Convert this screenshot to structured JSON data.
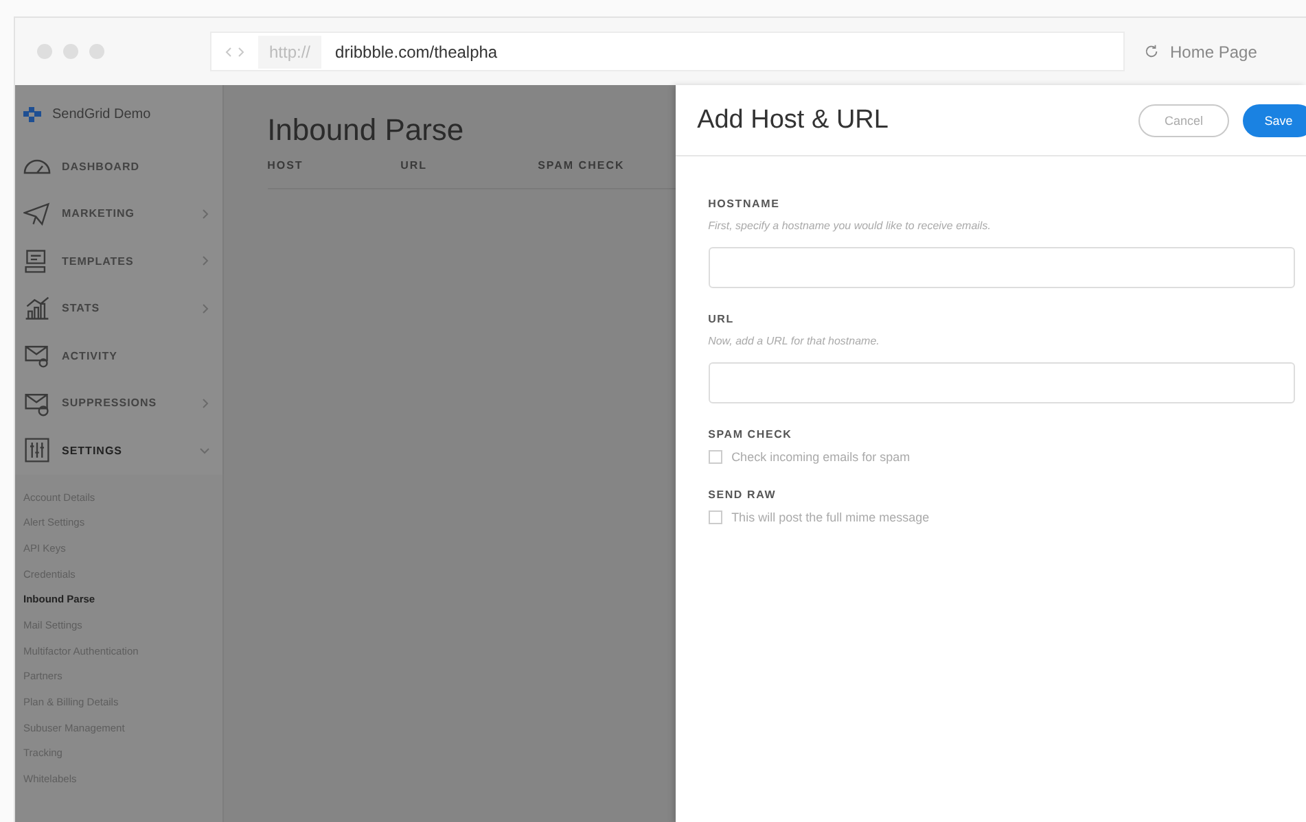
{
  "browser": {
    "protocol": "http://",
    "url": "dribbble.com/thealpha",
    "home_label": "Home Page"
  },
  "sidebar": {
    "account": "SendGrid Demo",
    "items": [
      {
        "label": "DASHBOARD",
        "kind": "link"
      },
      {
        "label": "MARKETING",
        "kind": "group",
        "expanded": false
      },
      {
        "label": "TEMPLATES",
        "kind": "group",
        "expanded": false
      },
      {
        "label": "STATS",
        "kind": "group",
        "expanded": false
      },
      {
        "label": "ACTIVITY",
        "kind": "link"
      },
      {
        "label": "SUPPRESSIONS",
        "kind": "group",
        "expanded": false
      },
      {
        "label": "SETTINGS",
        "kind": "group",
        "expanded": true
      }
    ],
    "subitems": [
      {
        "label": "Account Details",
        "selected": false
      },
      {
        "label": "Alert Settings",
        "selected": false
      },
      {
        "label": "API Keys",
        "selected": false
      },
      {
        "label": "Credentials",
        "selected": false
      },
      {
        "label": "Inbound Parse",
        "selected": true
      },
      {
        "label": "Mail Settings",
        "selected": false
      },
      {
        "label": "Multifactor Authentication",
        "selected": false
      },
      {
        "label": "Partners",
        "selected": false
      },
      {
        "label": "Plan & Billing Details",
        "selected": false
      },
      {
        "label": "Subuser Management",
        "selected": false
      },
      {
        "label": "Tracking",
        "selected": false
      },
      {
        "label": "Whitelabels",
        "selected": false
      }
    ]
  },
  "main": {
    "title": "Inbound Parse",
    "columns": [
      "HOST",
      "URL",
      "SPAM CHECK"
    ]
  },
  "panel": {
    "title": "Add Host & URL",
    "buttons": [
      {
        "label": "Cancel",
        "kind": "secondary"
      },
      {
        "label": "Save",
        "kind": "primary"
      }
    ],
    "fields": [
      {
        "kind": "text",
        "label": "HOSTNAME",
        "hint": "First, specify a hostname you would like to receive emails."
      },
      {
        "kind": "text",
        "label": "URL",
        "hint": "Now, add a URL for that hostname."
      },
      {
        "kind": "checkbox",
        "label": "SPAM CHECK",
        "option": "Check incoming emails for spam",
        "checked": false
      },
      {
        "kind": "checkbox",
        "label": "SEND RAW",
        "option": "This will post the full mime message",
        "checked": false
      }
    ]
  }
}
